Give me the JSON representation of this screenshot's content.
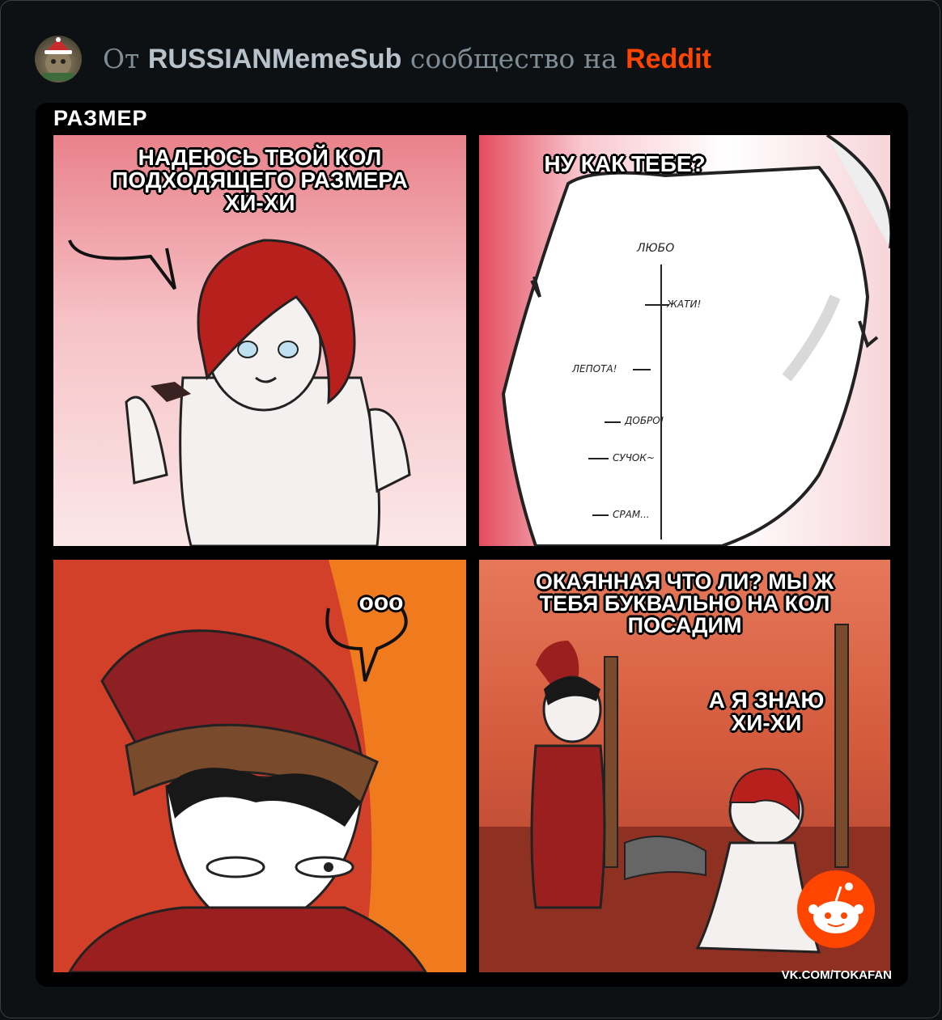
{
  "header": {
    "prefix": "От",
    "community": "RUSSIANMemeSub",
    "middle": "сообщество на",
    "brand": "Reddit"
  },
  "comic": {
    "title": "РАЗМЕР",
    "panel1": {
      "speech": "НАДЕЮСЬ ТВОЙ КОЛ\nПОДХОДЯЩЕГО РАЗМЕРА\nХИ-ХИ"
    },
    "panel2": {
      "speech": "НУ КАК ТЕБЕ?",
      "scale": {
        "top": "ЛЮБО",
        "marks": [
          "ЖАТИ!",
          "ЛЕПОТА!",
          "ДОБРО!",
          "СУЧОК~",
          "СРАМ..."
        ]
      }
    },
    "panel3": {
      "speech": "ooo"
    },
    "panel4": {
      "speech_guard": "ОКАЯННАЯ ЧТО ЛИ? МЫ Ж\nТЕБЯ БУКВАЛЬНО НА КОЛ\nПОСАДИМ",
      "speech_girl": "А Я ЗНАЮ\nХИ-ХИ"
    },
    "credit": "VK.COM/TOKAFAN"
  },
  "colors": {
    "brand": "#ff4500",
    "background": "#0e1113"
  }
}
